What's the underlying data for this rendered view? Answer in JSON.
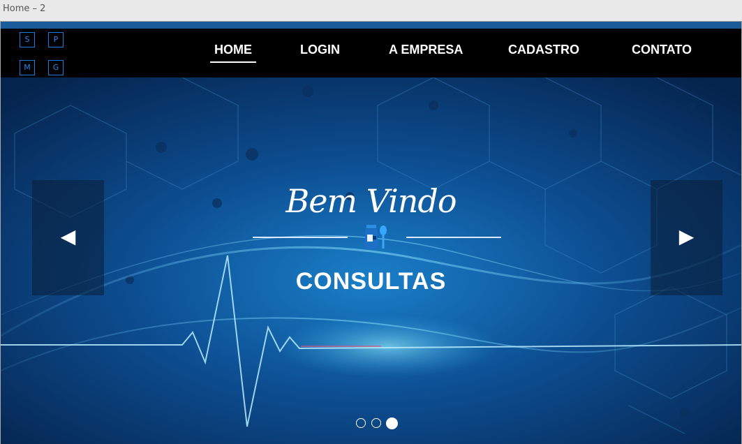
{
  "window": {
    "title": "Home – 2"
  },
  "logo": {
    "letters": [
      "S",
      "P",
      "M",
      "G"
    ]
  },
  "nav": {
    "items": [
      {
        "label": "HOME",
        "active": true
      },
      {
        "label": "LOGIN",
        "active": false
      },
      {
        "label": "A EMPRESA",
        "active": false
      },
      {
        "label": "CADASTRO",
        "active": false
      },
      {
        "label": "CONTATO",
        "active": false
      }
    ]
  },
  "slider": {
    "welcome_text": "Bem Vindo",
    "slide_title": "CONSULTAS",
    "prev_icon": "triangle-left-icon",
    "next_icon": "triangle-right-icon",
    "prev_glyph": "◀",
    "next_glyph": "▶",
    "dots": [
      {
        "active": false
      },
      {
        "active": false
      },
      {
        "active": true
      }
    ],
    "center_icon": "medicine-bottle-spoon-icon"
  },
  "colors": {
    "navbar": "#000000",
    "hero_dark": "#062a55",
    "hero_mid": "#0c4c8a",
    "accent_glow": "#5fd6ff",
    "logo_blue": "#1e7be0"
  }
}
